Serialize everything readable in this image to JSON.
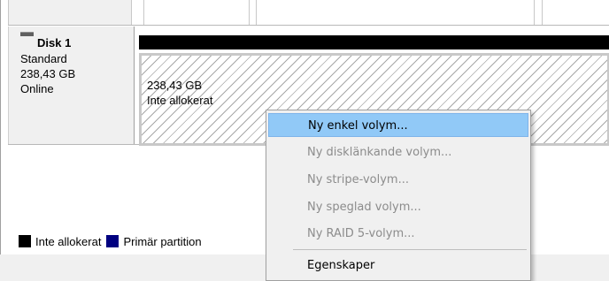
{
  "disk": {
    "title": "Disk 1",
    "kind": "Standard",
    "size": "238,43 GB",
    "status": "Online"
  },
  "partition": {
    "size": "238,43 GB",
    "label": "Inte allokerat"
  },
  "legend": {
    "items": [
      {
        "label": "Inte allokerat",
        "color": "#000000"
      },
      {
        "label": "Primär partition",
        "color": "#000080"
      }
    ]
  },
  "context_menu": {
    "items": [
      {
        "label": "Ny enkel volym...",
        "enabled": true,
        "highlighted": true
      },
      {
        "label": "Ny disklänkande volym...",
        "enabled": false
      },
      {
        "label": "Ny stripe-volym...",
        "enabled": false
      },
      {
        "label": "Ny speglad volym...",
        "enabled": false
      },
      {
        "label": "Ny RAID 5-volym...",
        "enabled": false
      },
      {
        "label": "Egenskaper",
        "enabled": true
      }
    ]
  },
  "colors": {
    "menu_highlight": "#91c9f7",
    "unallocated": "#000000",
    "primary_partition": "#000080"
  }
}
